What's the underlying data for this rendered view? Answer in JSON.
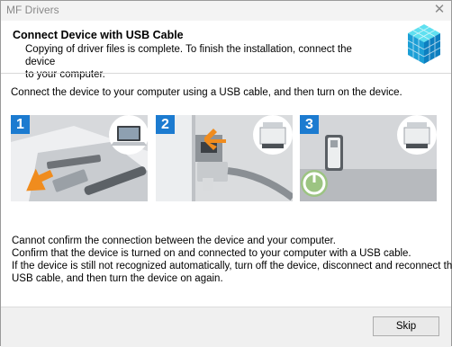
{
  "window": {
    "title": "MF Drivers",
    "close_glyph": "✕"
  },
  "header": {
    "title": "Connect Device with USB Cable",
    "subtitle_line1": "Copying of driver files is complete. To finish the installation, connect the device",
    "subtitle_line2": "to your computer.",
    "logo_icon": "package-cubes-icon"
  },
  "instruction": "Connect the device to your computer using a USB cable, and then turn on the device.",
  "steps": [
    {
      "number": "1",
      "icon": "laptop-usb-port-icon"
    },
    {
      "number": "2",
      "icon": "printer-usb-port-icon"
    },
    {
      "number": "3",
      "icon": "printer-power-button-icon"
    }
  ],
  "message": {
    "line1": "Cannot confirm the connection between the device and your computer.",
    "line2": "Confirm that the device is turned on and connected to your computer with a USB cable.",
    "line3": "If the device is still not recognized automatically, turn off the device, disconnect and reconnect the",
    "line4": "USB cable, and then turn the device on again."
  },
  "footer": {
    "skip_label": "Skip"
  },
  "colors": {
    "accent_blue": "#1c7bd0",
    "arrow_orange": "#f08c1e",
    "power_green": "#7cd13a"
  }
}
